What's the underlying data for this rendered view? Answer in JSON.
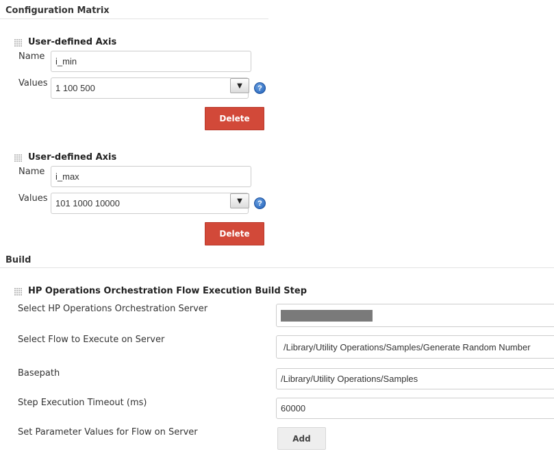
{
  "configuration_matrix": {
    "title": "Configuration Matrix",
    "axes": [
      {
        "title": "User-defined Axis",
        "name_label": "Name",
        "name_value": "i_min",
        "values_label": "Values",
        "values_value": "1 100 500",
        "expand_glyph": "▼",
        "help_glyph": "?",
        "delete_label": "Delete"
      },
      {
        "title": "User-defined Axis",
        "name_label": "Name",
        "name_value": "i_max",
        "values_label": "Values",
        "values_value": "101 1000 10000",
        "expand_glyph": "▼",
        "help_glyph": "?",
        "delete_label": "Delete"
      }
    ]
  },
  "build": {
    "title": "Build",
    "step": {
      "title": "HP Operations Orchestration Flow Execution Build Step",
      "server_label": "Select HP Operations Orchestration Server",
      "server_value": "",
      "flow_label": "Select Flow to Execute on Server",
      "flow_value": "/Library/Utility Operations/Samples/Generate Random Number",
      "basepath_label": "Basepath",
      "basepath_value": "/Library/Utility Operations/Samples",
      "timeout_label": "Step Execution Timeout (ms)",
      "timeout_value": "60000",
      "params_label": "Set Parameter Values for Flow on Server",
      "add_label": "Add"
    }
  },
  "colors": {
    "delete_button": "#d24939",
    "help_icon": "#1f5fb8",
    "redaction": "#7a7a7a"
  }
}
